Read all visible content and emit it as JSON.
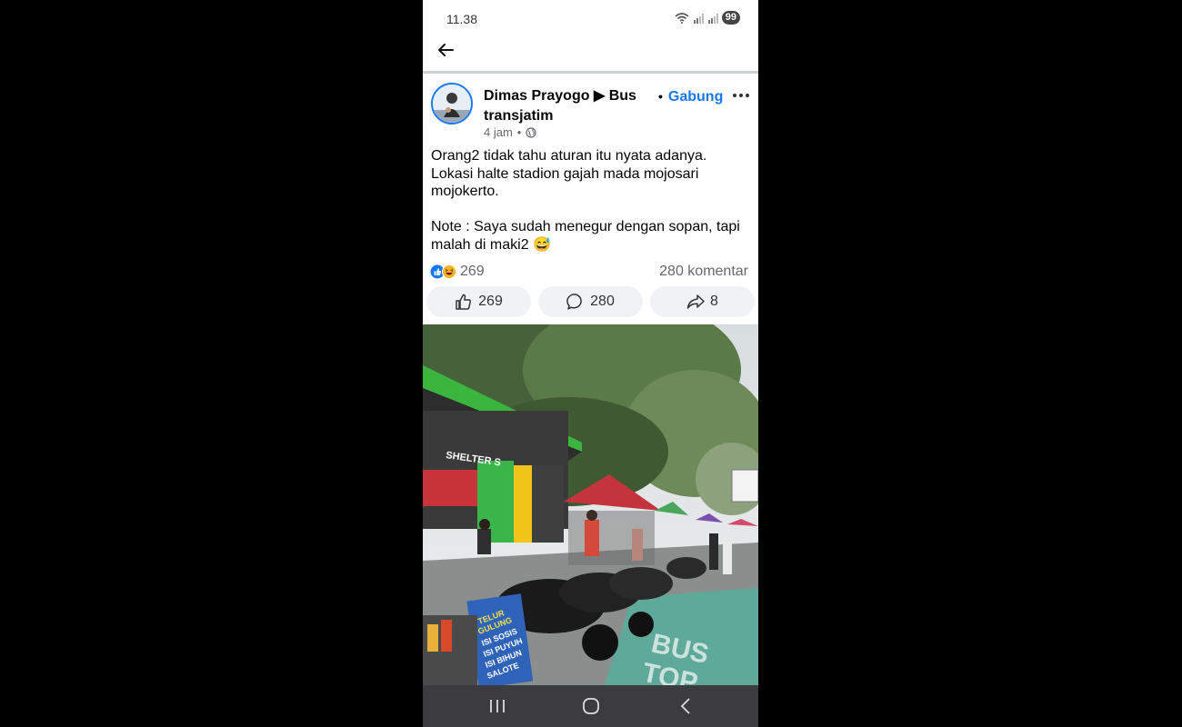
{
  "status_bar": {
    "time": "11.38",
    "battery": "99"
  },
  "post": {
    "author": "Dimas Prayogo",
    "group": "Bus transjatim",
    "join_label": "Gabung",
    "time_ago": "4 jam",
    "text_lines": [
      "Orang2 tidak tahu aturan itu nyata adanya.",
      "Lokasi halte stadion gajah mada mojosari",
      "mojokerto."
    ],
    "note_lines": [
      "Note : Saya sudah menegur dengan sopan, tapi",
      "malah di maki2 😅"
    ],
    "reaction_count": "269",
    "comment_count_label": "280 komentar",
    "actions": {
      "like": "269",
      "comment": "280",
      "share": "8"
    }
  },
  "photo": {
    "shelter_sign": "SHELTER S",
    "menu_sign": [
      "TELUR",
      "GULUNG",
      "ISI SOSIS",
      "ISI PUYUH",
      "ISI BIHUN",
      "SALOTE"
    ],
    "road_marking": [
      "BUS",
      "TOP"
    ]
  },
  "colors": {
    "accent": "#1877f2",
    "navbar": "#3c3c3e"
  }
}
